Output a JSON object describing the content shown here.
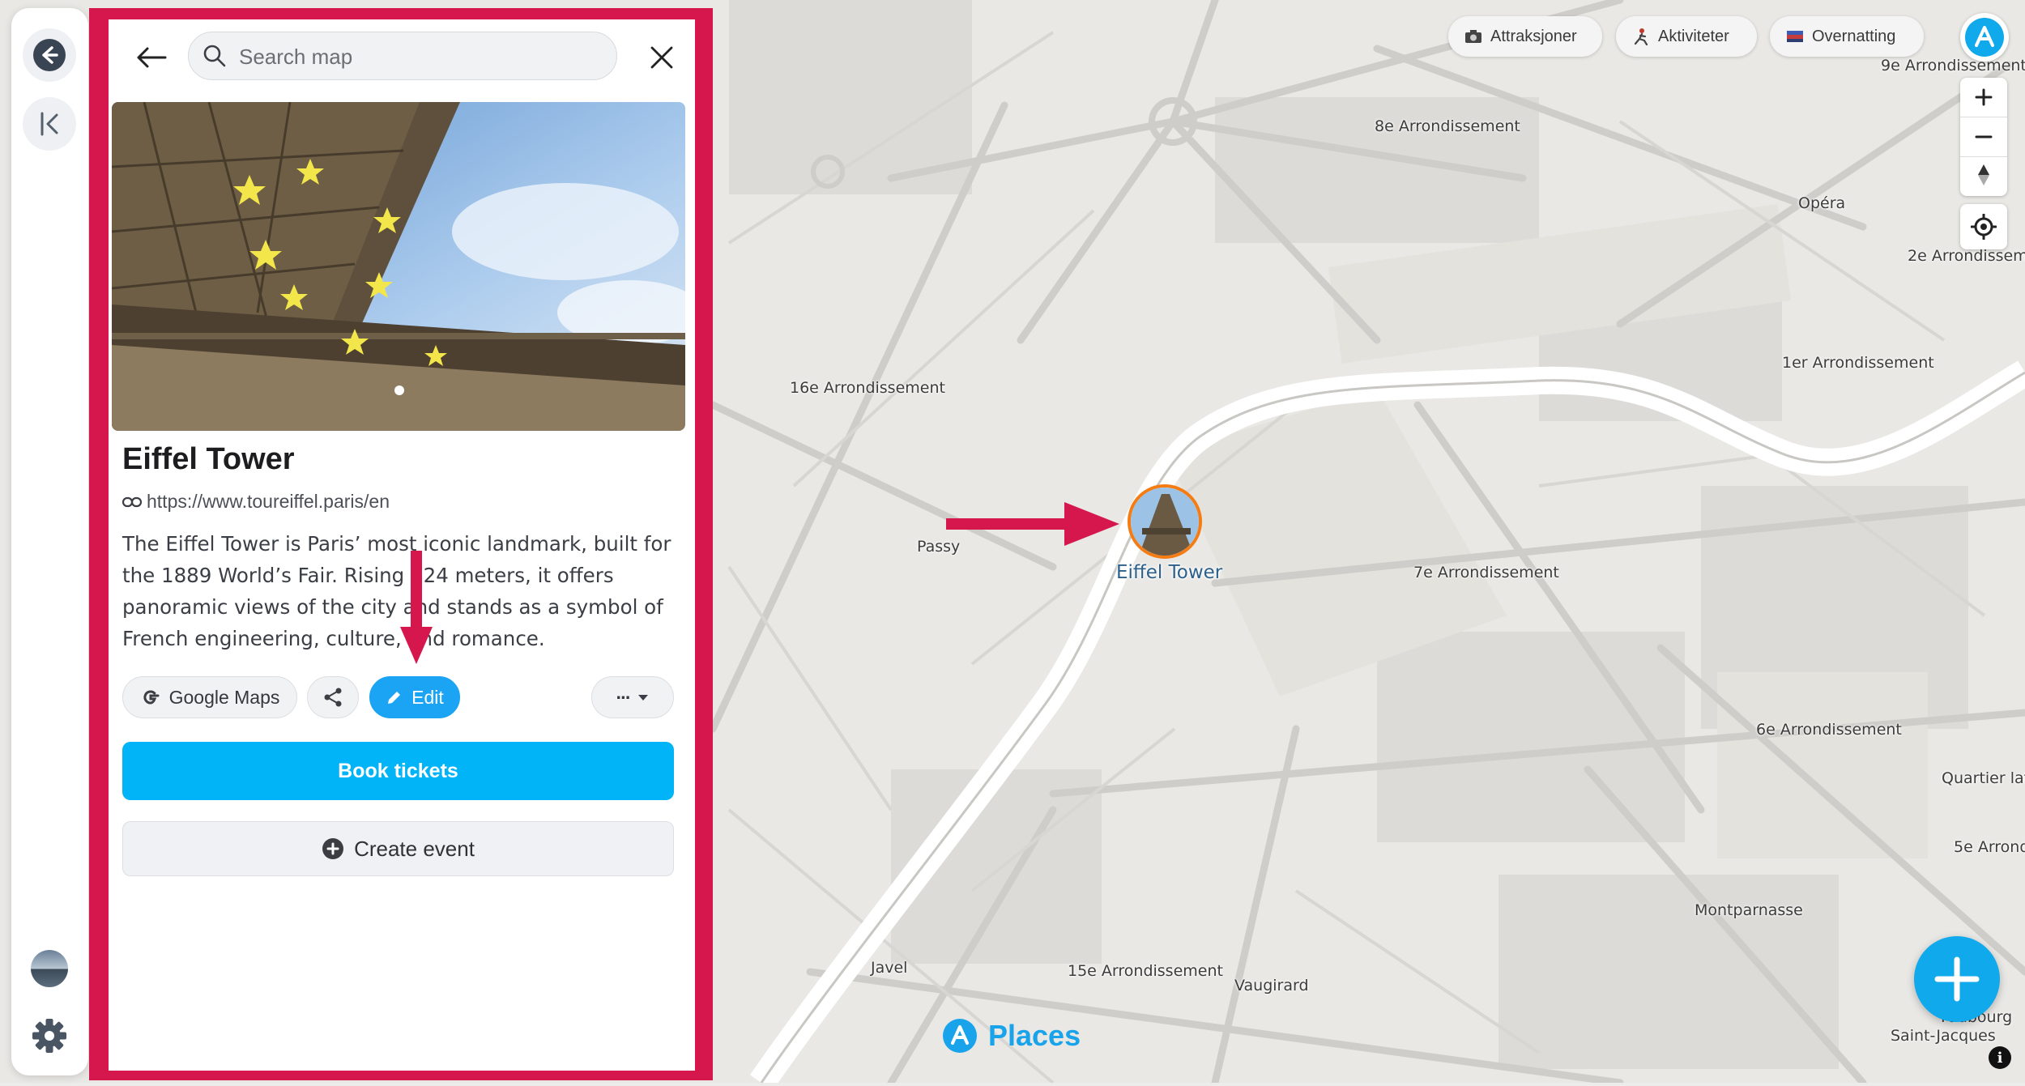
{
  "search": {
    "placeholder": "Search map"
  },
  "poi": {
    "title": "Eiffel Tower",
    "url": "https://www.toureiffel.paris/en",
    "description": "The Eiffel Tower is Paris’ most iconic landmark, built for the 1889 World’s Fair. Rising 324 meters, it offers panoramic views of the city and stands as a symbol of French engineering, culture, and romance."
  },
  "actions": {
    "google_maps": "Google Maps",
    "edit": "Edit",
    "more": "···",
    "book": "Book tickets",
    "create_event": "Create event"
  },
  "filters": [
    {
      "label": "Attraksjoner",
      "icon": "camera-icon"
    },
    {
      "label": "Aktiviteter",
      "icon": "activity-icon"
    },
    {
      "label": "Overnatting",
      "icon": "bed-icon"
    }
  ],
  "map": {
    "marker_label": "Eiffel Tower",
    "brand": "Places",
    "districts": [
      "9e Arrondissement",
      "8e Arrondissement",
      "Opéra",
      "2e Arrondisseme",
      "1er Arrondissement",
      "16e Arrondissement",
      "Passy",
      "7e Arrondissement",
      "6e Arrondissement",
      "Quartier lati",
      "5e Arrond",
      "Montparnasse",
      "Javel",
      "15e Arrondissement",
      "Vaugirard",
      "Faubourg",
      "Saint-Jacques"
    ]
  },
  "colors": {
    "highlight": "#d6174e",
    "accent": "#00b4f7",
    "marker_ring": "#f57c12"
  }
}
